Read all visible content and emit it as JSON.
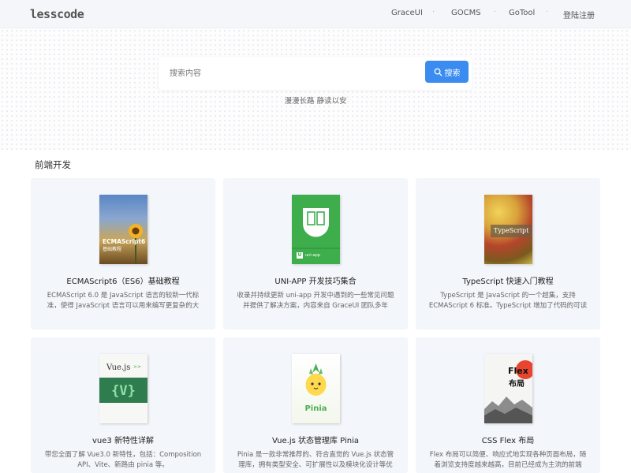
{
  "header": {
    "logo": "lesscode",
    "nav": [
      "GraceUI",
      "GOCMS",
      "GoTool",
      "登陆注册"
    ]
  },
  "search": {
    "placeholder": "搜索内容",
    "button_label": "搜索",
    "slogan": "漫漫长路 静读以安"
  },
  "section": {
    "title": "前端开发"
  },
  "cards": [
    {
      "title": "ECMAScript6（ES6）基础教程",
      "desc": "ECMAScript 6.0 是 JavaScript 语言的较新一代标准，使得 JavaScript 语言可以用来编写更复杂的大",
      "cover_title": "ECMAScript6",
      "cover_subtitle": "基础教程"
    },
    {
      "title": "UNI-APP 开发技巧集合",
      "desc": "收录并持续更新 uni-app 开发中遇到的一些常见问题并提供了解决方案，内容来自 GraceUI 团队多年",
      "cover_title": "uni-app",
      "cover_badge": "U"
    },
    {
      "title": "TypeScript 快速入门教程",
      "desc": "TypeScript 是 JavaScript 的一个超集，支持 ECMAScript 6 标准。TypeScript 增加了代码的可读",
      "cover_title": "TypeScript"
    },
    {
      "title": "vue3 新特性详解",
      "desc": "带您全面了解 Vue3.0 新特性，包括：Composition API、Vite、新路由 pinia 等。",
      "cover_title": "Vue.js",
      "cover_suffix": ">>"
    },
    {
      "title": "Vue.js 状态管理库 Pinia",
      "desc": "Pinia 是一款非常推荐的、符合直觉的 Vue.js 状态管理库，拥有类型安全、可扩展性以及模块化设计等优",
      "cover_title": "Pinia"
    },
    {
      "title": "CSS Flex 布局",
      "desc": "Flex 布局可以简便、响应式地实现各种页面布局，随着浏览支持度越来越高，目前已经成为主流的前端",
      "cover_title": "Flex",
      "cover_subtitle": "布局"
    }
  ],
  "colors": {
    "accent": "#3b8cf0",
    "card_bg": "#f3f6fa",
    "uni_green": "#3dae4b",
    "vue_green": "#2f7d4f"
  }
}
